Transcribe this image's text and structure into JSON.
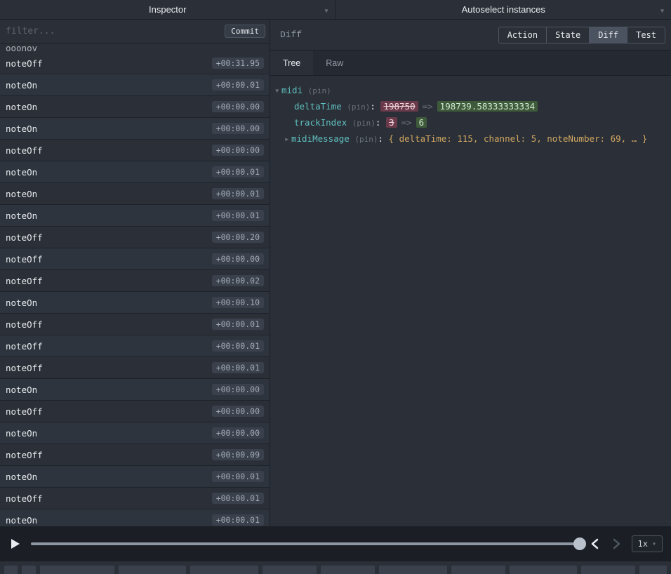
{
  "header": {
    "tabs": [
      {
        "label": "Inspector"
      },
      {
        "label": "Autoselect instances"
      }
    ]
  },
  "left": {
    "filterPlaceholder": "filter...",
    "commitLabel": "Commit",
    "cutRowName": "ooonov",
    "events": [
      {
        "name": "noteOff",
        "time": "+00:31.95"
      },
      {
        "name": "noteOn",
        "time": "+00:00.01"
      },
      {
        "name": "noteOn",
        "time": "+00:00.00"
      },
      {
        "name": "noteOn",
        "time": "+00:00.00"
      },
      {
        "name": "noteOff",
        "time": "+00:00:00"
      },
      {
        "name": "noteOn",
        "time": "+00:00.01"
      },
      {
        "name": "noteOn",
        "time": "+00:00.01"
      },
      {
        "name": "noteOn",
        "time": "+00:00.01"
      },
      {
        "name": "noteOff",
        "time": "+00:00.20"
      },
      {
        "name": "noteOff",
        "time": "+00:00.00"
      },
      {
        "name": "noteOff",
        "time": "+00:00.02"
      },
      {
        "name": "noteOn",
        "time": "+00:00.10"
      },
      {
        "name": "noteOff",
        "time": "+00:00.01"
      },
      {
        "name": "noteOff",
        "time": "+00:00.01"
      },
      {
        "name": "noteOff",
        "time": "+00:00.01"
      },
      {
        "name": "noteOn",
        "time": "+00:00.00"
      },
      {
        "name": "noteOff",
        "time": "+00:00.00"
      },
      {
        "name": "noteOn",
        "time": "+00:00.00"
      },
      {
        "name": "noteOff",
        "time": "+00:00.09"
      },
      {
        "name": "noteOn",
        "time": "+00:00.01"
      },
      {
        "name": "noteOff",
        "time": "+00:00.01"
      },
      {
        "name": "noteOn",
        "time": "+00:00.01"
      }
    ]
  },
  "right": {
    "title": "Diff",
    "buttons": [
      "Action",
      "State",
      "Diff",
      "Test"
    ],
    "activeButton": "Diff",
    "subtabs": [
      "Tree",
      "Raw"
    ],
    "activeSubtab": "Tree",
    "tree": {
      "root": "midi",
      "pinLabel": "(pin)",
      "colon": ":",
      "rows": [
        {
          "key": "deltaTime",
          "old": "198750",
          "new": "198739.58333333334"
        },
        {
          "key": "trackIndex",
          "old": "3",
          "new": "6"
        }
      ],
      "midiMessage": {
        "key": "midiMessage",
        "preview": "{ deltaTime: 115, channel: 5, noteNumber: 69, … }"
      },
      "arrow": "=>"
    }
  },
  "playback": {
    "speed": "1x"
  },
  "bottomStrip": [
    20,
    20,
    110,
    100,
    100,
    80,
    80,
    100,
    80,
    100,
    80,
    40
  ]
}
